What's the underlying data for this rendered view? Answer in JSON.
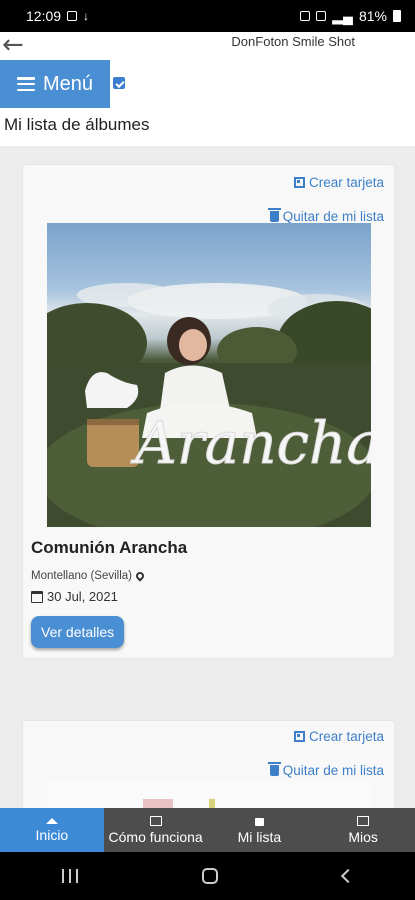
{
  "status_bar": {
    "time": "12:09",
    "battery": "81%"
  },
  "app": {
    "brand": "DonFoton Smile Shot",
    "menu_label": "Menú",
    "page_title": "Mi lista de álbumes"
  },
  "albums": [
    {
      "create_card_label": "Crear tarjeta",
      "remove_label": "Quitar de mi lista",
      "title": "Comunión Arancha",
      "location": "Montellano (Sevilla)",
      "date": "30 Jul, 2021",
      "details_label": "Ver detalles"
    },
    {
      "create_card_label": "Crear tarjeta",
      "remove_label": "Quitar de mi lista"
    }
  ],
  "bottom_nav": {
    "items": [
      {
        "label": "Inicio",
        "icon": "home-icon",
        "active": true
      },
      {
        "label": "Cómo funciona",
        "icon": "id-card-icon",
        "active": false
      },
      {
        "label": "Mi lista",
        "icon": "lock-icon",
        "active": false
      },
      {
        "label": "Mios",
        "icon": "image-icon",
        "active": false
      }
    ]
  },
  "colors": {
    "accent": "#4a8fd4",
    "link": "#3d7fc9",
    "nav_bg": "#4d4d4d",
    "nav_active": "#3c8ad6"
  }
}
